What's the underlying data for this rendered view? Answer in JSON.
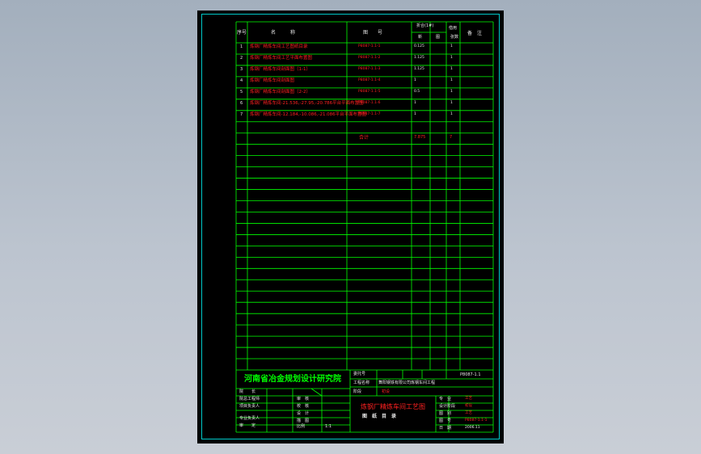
{
  "table": {
    "headers": {
      "no": "序号",
      "name": "名　　　称",
      "drawing_no": "图　　号",
      "sheets": "折合(1#)",
      "new": "新",
      "ref": "图",
      "prev": "借用",
      "count": "张数",
      "remark": "备　注"
    },
    "rows": [
      {
        "no": "1",
        "name": "炼钢厂精炼车间工艺图纸目录",
        "code": "P8087-1.1-1",
        "qty": "0.125",
        "pages": "1"
      },
      {
        "no": "2",
        "name": "炼钢厂精炼车间工艺平面布置图",
        "code": "P8087-1.1-2",
        "qty": "1.125",
        "pages": "1"
      },
      {
        "no": "3",
        "name": "炼钢厂精炼车间剖面图（1-1）",
        "code": "P8087-1.1-3",
        "qty": "1.125",
        "pages": "1"
      },
      {
        "no": "4",
        "name": "炼钢厂精炼车间剖面图",
        "code": "P8087-1.1-4",
        "qty": "1",
        "pages": "1"
      },
      {
        "no": "5",
        "name": "炼钢厂精炼车间剖面图（2-2）",
        "code": "P8087-1.1-5",
        "qty": "0.5",
        "pages": "1"
      },
      {
        "no": "6",
        "name": "炼钢厂精炼车间-21.536,-27.95,-20.786平台平面布置图",
        "code": "P8087-1.1-6",
        "qty": "1",
        "pages": "1"
      },
      {
        "no": "7",
        "name": "炼钢厂精炼车间-12.184,-10.086,-21.086平台平面布置图",
        "code": "P8087-1.1-7",
        "qty": "1",
        "pages": "1"
      }
    ],
    "total_label": "合计",
    "total_qty": "7.875",
    "total_pages": "7"
  },
  "title_block": {
    "institute": "河南省冶金规划设计研究院",
    "project_code_label": "委托号",
    "project_code": "P8087-1.1",
    "project_name_label": "工程名称",
    "project_name": "舞阳钢铁有限公司炼钢车间工程",
    "stage_label": "阶段",
    "stage": "初设",
    "drawing_title": "炼钢厂精炼车间工艺图",
    "drawing_subtitle": "图　纸　目　录",
    "roles": [
      "院　　长",
      "院总工程师",
      "项目负责人",
      "专业负责人",
      "审　　定"
    ],
    "roles2": [
      "审　核",
      "校　核",
      "设　计",
      "描　图"
    ],
    "scale_label": "比例",
    "scale_value": "1:1",
    "meta_labels": [
      "专　业",
      "设计阶段",
      "图　别",
      "图　号",
      "日　期"
    ],
    "meta_values": [
      "工艺",
      "初设",
      "工艺",
      "P8087-1.1-1",
      "2006.11"
    ]
  }
}
